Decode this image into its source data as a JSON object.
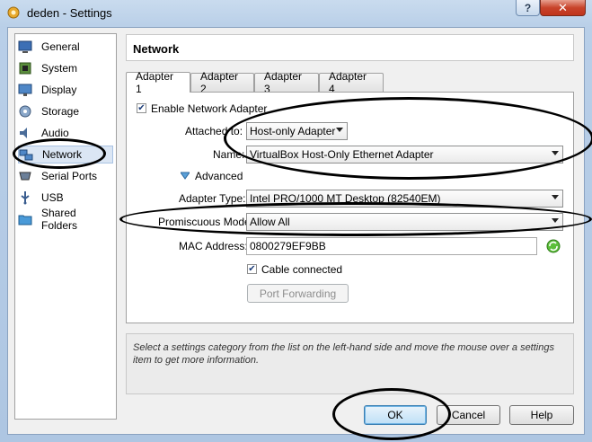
{
  "window": {
    "title": "deden - Settings",
    "help_glyph": "?",
    "close_glyph": "✕"
  },
  "sidebar": {
    "items": [
      {
        "label": "General",
        "icon": "general-icon"
      },
      {
        "label": "System",
        "icon": "system-icon"
      },
      {
        "label": "Display",
        "icon": "display-icon"
      },
      {
        "label": "Storage",
        "icon": "storage-icon"
      },
      {
        "label": "Audio",
        "icon": "audio-icon"
      },
      {
        "label": "Network",
        "icon": "network-icon",
        "selected": true
      },
      {
        "label": "Serial Ports",
        "icon": "serial-ports-icon"
      },
      {
        "label": "USB",
        "icon": "usb-icon"
      },
      {
        "label": "Shared Folders",
        "icon": "shared-folders-icon"
      }
    ]
  },
  "page": {
    "title": "Network"
  },
  "tabs": [
    {
      "label": "Adapter 1",
      "active": true
    },
    {
      "label": "Adapter 2"
    },
    {
      "label": "Adapter 3"
    },
    {
      "label": "Adapter 4"
    }
  ],
  "adapter": {
    "enable_label": "Enable Network Adapter",
    "enable_checked": true,
    "attached_label": "Attached to:",
    "attached_value": "Host-only Adapter",
    "name_label": "Name:",
    "name_value": "VirtualBox Host-Only Ethernet Adapter",
    "advanced_label": "Advanced",
    "type_label": "Adapter Type:",
    "type_value": "Intel PRO/1000 MT Desktop (82540EM)",
    "promisc_label": "Promiscuous Mode:",
    "promisc_value": "Allow All",
    "mac_label": "MAC Address:",
    "mac_value": "0800279EF9BB",
    "cable_label": "Cable connected",
    "cable_checked": true,
    "port_forwarding_label": "Port Forwarding"
  },
  "info": {
    "text": "Select a settings category from the list on the left-hand side and move the mouse over a settings item to get more information."
  },
  "buttons": {
    "ok": "OK",
    "cancel": "Cancel",
    "help": "Help"
  },
  "check_glyph": "✔"
}
